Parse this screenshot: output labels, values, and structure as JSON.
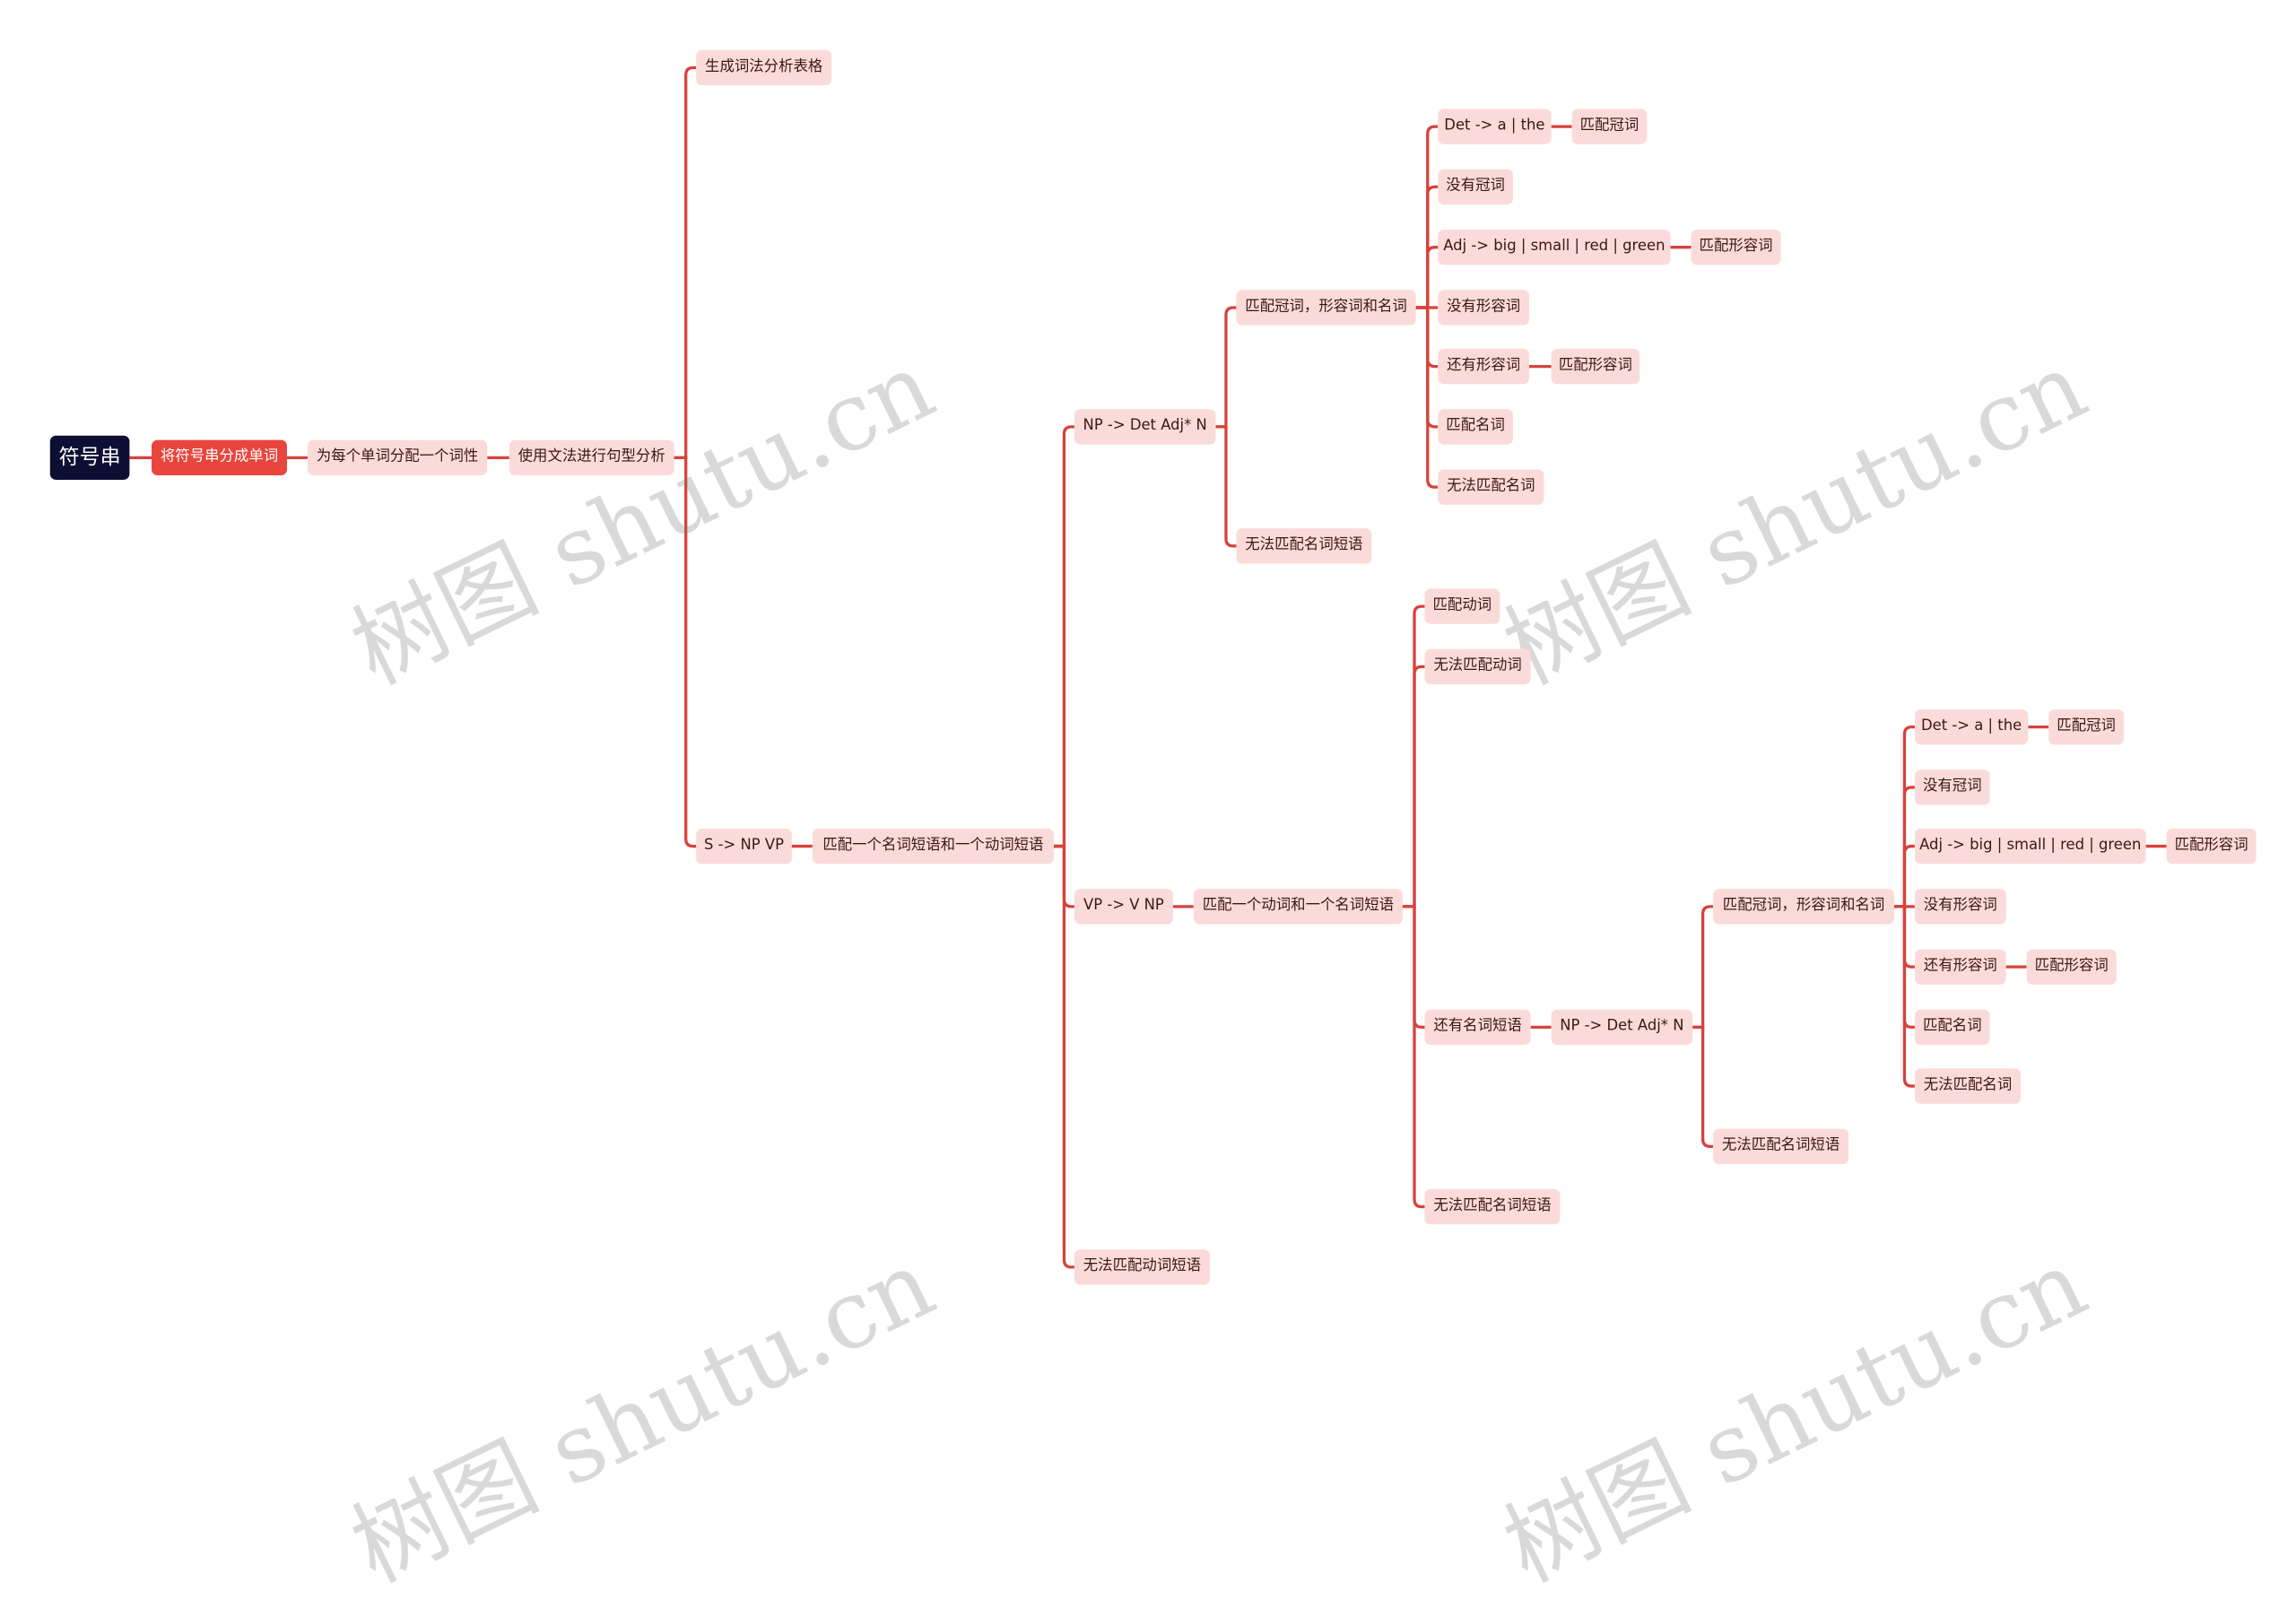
{
  "mindmap": {
    "nodes": [
      "符号串",
      "将符号串分成单词",
      "为每个单词分配一个词性",
      "使用文法进行句型分析",
      "生成词法分析表格",
      "S -> NP VP",
      "匹配一个名词短语和一个动词短语",
      "NP -> Det Adj* N",
      "VP -> V NP",
      "无法匹配动词短语",
      "匹配冠词，形容词和名词",
      "无法匹配名词短语",
      "Det -> a | the",
      "匹配冠词",
      "没有冠词",
      "Adj -> big | small | red | green",
      "匹配形容词",
      "没有形容词",
      "还有形容词",
      "匹配形容词",
      "匹配名词",
      "无法匹配名词",
      "匹配一个动词和一个名词短语",
      "匹配动词",
      "无法匹配动词",
      "还有名词短语",
      "NP -> Det Adj* N",
      "无法匹配名词短语",
      "匹配冠词，形容词和名词",
      "无法匹配名词短语",
      "Det -> a | the",
      "匹配冠词",
      "没有冠词",
      "Adj -> big | small | red | green",
      "匹配形容词",
      "没有形容词",
      "还有形容词",
      "匹配形容词",
      "匹配名词",
      "无法匹配名词"
    ]
  },
  "watermark": "树图 shutu.cn",
  "colors": {
    "root": "#0c0e33",
    "first": "#e8453c",
    "node": "#fbdbd9",
    "line": "#d8423a"
  }
}
